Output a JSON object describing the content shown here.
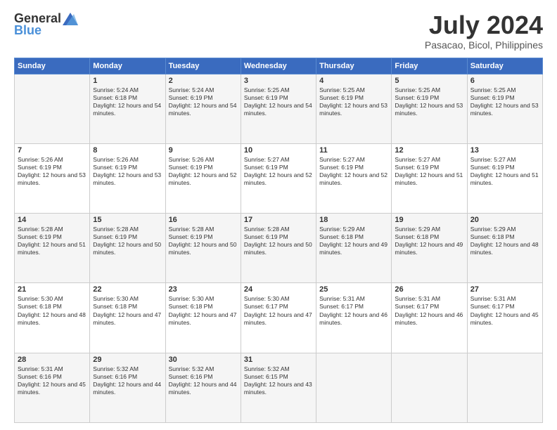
{
  "header": {
    "logo_general": "General",
    "logo_blue": "Blue",
    "month_year": "July 2024",
    "location": "Pasacao, Bicol, Philippines"
  },
  "weekdays": [
    "Sunday",
    "Monday",
    "Tuesday",
    "Wednesday",
    "Thursday",
    "Friday",
    "Saturday"
  ],
  "weeks": [
    [
      {
        "day": "",
        "sunrise": "",
        "sunset": "",
        "daylight": ""
      },
      {
        "day": "1",
        "sunrise": "Sunrise: 5:24 AM",
        "sunset": "Sunset: 6:18 PM",
        "daylight": "Daylight: 12 hours and 54 minutes."
      },
      {
        "day": "2",
        "sunrise": "Sunrise: 5:24 AM",
        "sunset": "Sunset: 6:19 PM",
        "daylight": "Daylight: 12 hours and 54 minutes."
      },
      {
        "day": "3",
        "sunrise": "Sunrise: 5:25 AM",
        "sunset": "Sunset: 6:19 PM",
        "daylight": "Daylight: 12 hours and 54 minutes."
      },
      {
        "day": "4",
        "sunrise": "Sunrise: 5:25 AM",
        "sunset": "Sunset: 6:19 PM",
        "daylight": "Daylight: 12 hours and 53 minutes."
      },
      {
        "day": "5",
        "sunrise": "Sunrise: 5:25 AM",
        "sunset": "Sunset: 6:19 PM",
        "daylight": "Daylight: 12 hours and 53 minutes."
      },
      {
        "day": "6",
        "sunrise": "Sunrise: 5:25 AM",
        "sunset": "Sunset: 6:19 PM",
        "daylight": "Daylight: 12 hours and 53 minutes."
      }
    ],
    [
      {
        "day": "7",
        "sunrise": "Sunrise: 5:26 AM",
        "sunset": "Sunset: 6:19 PM",
        "daylight": "Daylight: 12 hours and 53 minutes."
      },
      {
        "day": "8",
        "sunrise": "Sunrise: 5:26 AM",
        "sunset": "Sunset: 6:19 PM",
        "daylight": "Daylight: 12 hours and 53 minutes."
      },
      {
        "day": "9",
        "sunrise": "Sunrise: 5:26 AM",
        "sunset": "Sunset: 6:19 PM",
        "daylight": "Daylight: 12 hours and 52 minutes."
      },
      {
        "day": "10",
        "sunrise": "Sunrise: 5:27 AM",
        "sunset": "Sunset: 6:19 PM",
        "daylight": "Daylight: 12 hours and 52 minutes."
      },
      {
        "day": "11",
        "sunrise": "Sunrise: 5:27 AM",
        "sunset": "Sunset: 6:19 PM",
        "daylight": "Daylight: 12 hours and 52 minutes."
      },
      {
        "day": "12",
        "sunrise": "Sunrise: 5:27 AM",
        "sunset": "Sunset: 6:19 PM",
        "daylight": "Daylight: 12 hours and 51 minutes."
      },
      {
        "day": "13",
        "sunrise": "Sunrise: 5:27 AM",
        "sunset": "Sunset: 6:19 PM",
        "daylight": "Daylight: 12 hours and 51 minutes."
      }
    ],
    [
      {
        "day": "14",
        "sunrise": "Sunrise: 5:28 AM",
        "sunset": "Sunset: 6:19 PM",
        "daylight": "Daylight: 12 hours and 51 minutes."
      },
      {
        "day": "15",
        "sunrise": "Sunrise: 5:28 AM",
        "sunset": "Sunset: 6:19 PM",
        "daylight": "Daylight: 12 hours and 50 minutes."
      },
      {
        "day": "16",
        "sunrise": "Sunrise: 5:28 AM",
        "sunset": "Sunset: 6:19 PM",
        "daylight": "Daylight: 12 hours and 50 minutes."
      },
      {
        "day": "17",
        "sunrise": "Sunrise: 5:28 AM",
        "sunset": "Sunset: 6:19 PM",
        "daylight": "Daylight: 12 hours and 50 minutes."
      },
      {
        "day": "18",
        "sunrise": "Sunrise: 5:29 AM",
        "sunset": "Sunset: 6:18 PM",
        "daylight": "Daylight: 12 hours and 49 minutes."
      },
      {
        "day": "19",
        "sunrise": "Sunrise: 5:29 AM",
        "sunset": "Sunset: 6:18 PM",
        "daylight": "Daylight: 12 hours and 49 minutes."
      },
      {
        "day": "20",
        "sunrise": "Sunrise: 5:29 AM",
        "sunset": "Sunset: 6:18 PM",
        "daylight": "Daylight: 12 hours and 48 minutes."
      }
    ],
    [
      {
        "day": "21",
        "sunrise": "Sunrise: 5:30 AM",
        "sunset": "Sunset: 6:18 PM",
        "daylight": "Daylight: 12 hours and 48 minutes."
      },
      {
        "day": "22",
        "sunrise": "Sunrise: 5:30 AM",
        "sunset": "Sunset: 6:18 PM",
        "daylight": "Daylight: 12 hours and 47 minutes."
      },
      {
        "day": "23",
        "sunrise": "Sunrise: 5:30 AM",
        "sunset": "Sunset: 6:18 PM",
        "daylight": "Daylight: 12 hours and 47 minutes."
      },
      {
        "day": "24",
        "sunrise": "Sunrise: 5:30 AM",
        "sunset": "Sunset: 6:17 PM",
        "daylight": "Daylight: 12 hours and 47 minutes."
      },
      {
        "day": "25",
        "sunrise": "Sunrise: 5:31 AM",
        "sunset": "Sunset: 6:17 PM",
        "daylight": "Daylight: 12 hours and 46 minutes."
      },
      {
        "day": "26",
        "sunrise": "Sunrise: 5:31 AM",
        "sunset": "Sunset: 6:17 PM",
        "daylight": "Daylight: 12 hours and 46 minutes."
      },
      {
        "day": "27",
        "sunrise": "Sunrise: 5:31 AM",
        "sunset": "Sunset: 6:17 PM",
        "daylight": "Daylight: 12 hours and 45 minutes."
      }
    ],
    [
      {
        "day": "28",
        "sunrise": "Sunrise: 5:31 AM",
        "sunset": "Sunset: 6:16 PM",
        "daylight": "Daylight: 12 hours and 45 minutes."
      },
      {
        "day": "29",
        "sunrise": "Sunrise: 5:32 AM",
        "sunset": "Sunset: 6:16 PM",
        "daylight": "Daylight: 12 hours and 44 minutes."
      },
      {
        "day": "30",
        "sunrise": "Sunrise: 5:32 AM",
        "sunset": "Sunset: 6:16 PM",
        "daylight": "Daylight: 12 hours and 44 minutes."
      },
      {
        "day": "31",
        "sunrise": "Sunrise: 5:32 AM",
        "sunset": "Sunset: 6:15 PM",
        "daylight": "Daylight: 12 hours and 43 minutes."
      },
      {
        "day": "",
        "sunrise": "",
        "sunset": "",
        "daylight": ""
      },
      {
        "day": "",
        "sunrise": "",
        "sunset": "",
        "daylight": ""
      },
      {
        "day": "",
        "sunrise": "",
        "sunset": "",
        "daylight": ""
      }
    ]
  ]
}
